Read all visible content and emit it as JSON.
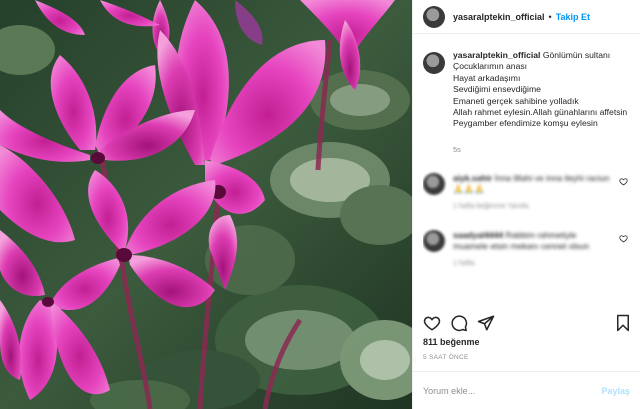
{
  "post": {
    "username": "yasaralptekin_official",
    "follow_label": "Takip Et",
    "separator": "•",
    "caption": {
      "username": "yasaralptekin_official",
      "lines": [
        "Gönlümün sultanı",
        "Çocuklarımın anası",
        "Hayat arkadaşımı",
        "Sevdiğimi ensevdiğime",
        "Emaneti gerçek sahibine yolladık",
        "Allah rahmet eylesin.Allah günahlarını affetsin Peygamber efendimize komşu eylesin"
      ],
      "time": "5s"
    },
    "comments": [
      {
        "username": "aiyk.sahir",
        "text": "İnna lillahi ve inna ileyhi raciun 🙏🙏🙏",
        "meta": "1 hafta   beğenme   Yanıtla"
      },
      {
        "username": "saadyal4444",
        "text": "Rabbim rahmetiyle muamele etsin mekanı cennet olsun",
        "meta": "1 hafta"
      }
    ],
    "likes": "811 beğenme",
    "posted": "5 SAAT ÖNCE",
    "comment_placeholder": "Yorum ekle...",
    "share_label": "Paylaş"
  },
  "icons": {
    "avatar": "avatar-icon",
    "like": "heart-icon",
    "comment": "comment-bubble-icon",
    "share": "paper-plane-icon",
    "save": "bookmark-icon",
    "comment_like": "heart-icon"
  },
  "colors": {
    "link": "#0095f6",
    "share_disabled": "#b2dffc",
    "muted": "#8e8e8e",
    "text": "#262626",
    "flower": "#e13bb4"
  }
}
